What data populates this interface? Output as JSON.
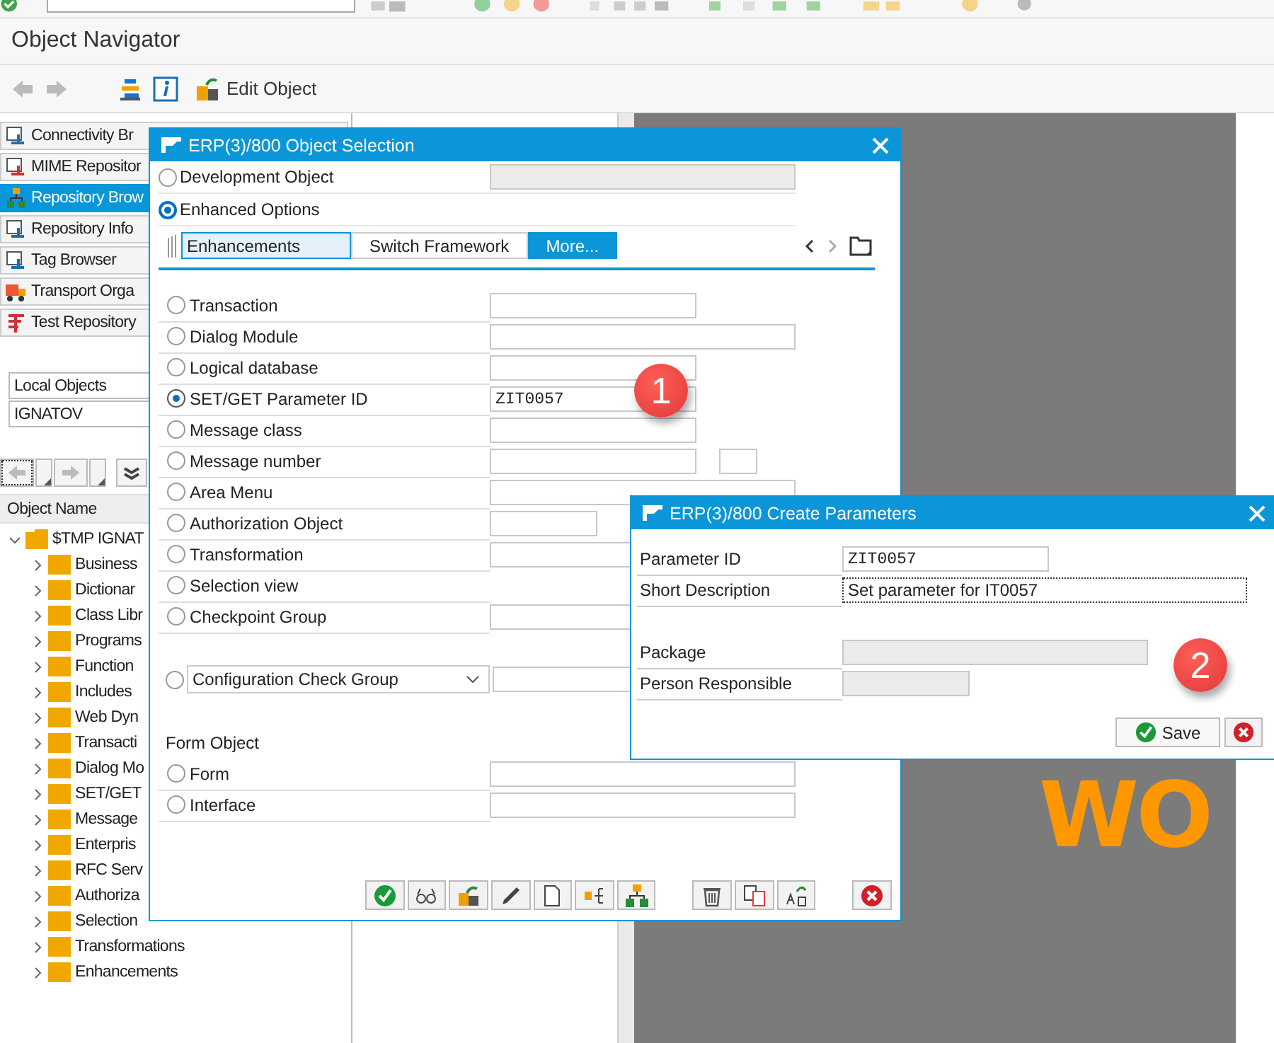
{
  "window": {
    "title": "Object Navigator"
  },
  "app_toolbar": {
    "edit_button": "Edit Object"
  },
  "nav_buttons": [
    {
      "label": "Connectivity Br",
      "selected": false
    },
    {
      "label": "MIME Repositor",
      "selected": false
    },
    {
      "label": "Repository Brow",
      "selected": true
    },
    {
      "label": "Repository Info",
      "selected": false
    },
    {
      "label": "Tag Browser",
      "selected": false
    },
    {
      "label": "Transport Orga",
      "selected": false
    },
    {
      "label": "Test Repository",
      "selected": false
    }
  ],
  "object_list": {
    "type": "Local Objects",
    "user": "IGNATOV"
  },
  "tree": {
    "header": "Object Name",
    "root": {
      "label": "$TMP IGNAT",
      "expanded": true,
      "children": [
        {
          "label": "Business",
          "expanded": false
        },
        {
          "label": "Dictionar",
          "expanded": false
        },
        {
          "label": "Class Libr",
          "expanded": false
        },
        {
          "label": "Programs",
          "expanded": false
        },
        {
          "label": "Function",
          "expanded": false
        },
        {
          "label": "Includes",
          "expanded": false
        },
        {
          "label": "Web Dyn",
          "expanded": false
        },
        {
          "label": "Transacti",
          "expanded": false
        },
        {
          "label": "Dialog Mo",
          "expanded": false
        },
        {
          "label": "SET/GET",
          "expanded": false
        },
        {
          "label": "Message",
          "expanded": false
        },
        {
          "label": "Enterpris",
          "expanded": false
        },
        {
          "label": "RFC Serv",
          "expanded": false
        },
        {
          "label": "Authoriza",
          "expanded": false
        },
        {
          "label": "Selection",
          "expanded": false
        },
        {
          "label": "Transformations",
          "expanded": false
        },
        {
          "label": "Enhancements",
          "expanded": false
        }
      ]
    }
  },
  "background_text": "WO",
  "object_selection": {
    "title": "ERP(3)/800 Object Selection",
    "modes": [
      {
        "label": "Development Object",
        "selected": false
      },
      {
        "label": "Enhanced Options",
        "selected": true
      }
    ],
    "tabs": [
      {
        "label": "Enhancements",
        "selected": false,
        "focused": true
      },
      {
        "label": "Switch Framework",
        "selected": false,
        "focused": false
      },
      {
        "label": "More...",
        "selected": true,
        "focused": false
      }
    ],
    "options": [
      {
        "label": "Transaction",
        "selected": false,
        "kind": "short"
      },
      {
        "label": "Dialog Module",
        "selected": false,
        "kind": "long"
      },
      {
        "label": "Logical database",
        "selected": false,
        "kind": "short"
      },
      {
        "label": "SET/GET Parameter ID",
        "selected": true,
        "kind": "short",
        "value": "ZIT0057"
      },
      {
        "label": "Message class",
        "selected": false,
        "kind": "short"
      },
      {
        "label": "Message number",
        "selected": false,
        "kind": "short",
        "extra_field": true
      },
      {
        "label": "Area Menu",
        "selected": false,
        "kind": "long"
      },
      {
        "label": "Authorization Object",
        "selected": false,
        "kind": "narrow"
      },
      {
        "label": "Transformation",
        "selected": false,
        "kind": "long"
      },
      {
        "label": "Selection view",
        "selected": false,
        "kind": "plain"
      },
      {
        "label": "Checkpoint Group",
        "selected": false,
        "kind": "long"
      }
    ],
    "check_group": {
      "label": "Configuration Check Group",
      "selected": false
    },
    "form_section": {
      "heading": "Form Object",
      "options": [
        {
          "label": "Form",
          "selected": false,
          "kind": "long"
        },
        {
          "label": "Interface",
          "selected": false,
          "kind": "long"
        }
      ]
    }
  },
  "create_parameters": {
    "title": "ERP(3)/800 Create Parameters",
    "fields": [
      {
        "label": "Parameter ID",
        "value": "ZIT0057",
        "kind": "mono"
      },
      {
        "label": "Short Description",
        "value": "Set parameter for IT0057",
        "kind": "focus"
      },
      {
        "label": "Package",
        "kind": "disabled"
      },
      {
        "label": "Person Responsible",
        "kind": "disabled_short"
      }
    ],
    "save_button": "Save"
  },
  "callouts": [
    "1",
    "2"
  ]
}
